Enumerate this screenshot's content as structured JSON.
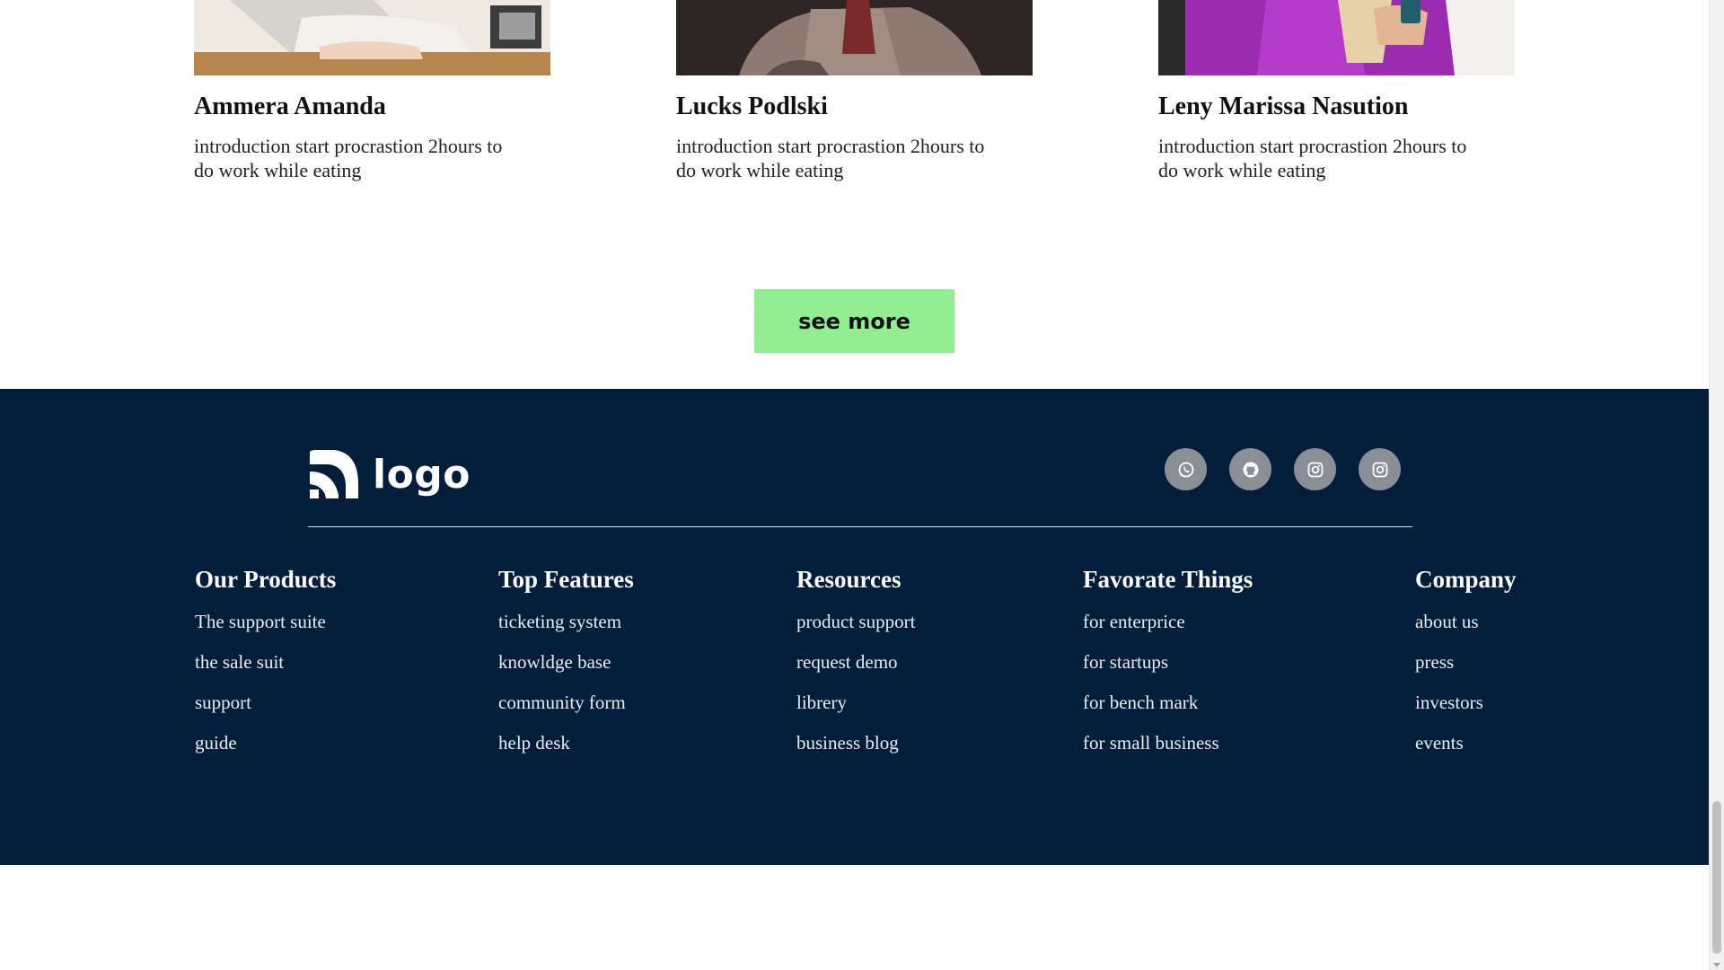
{
  "team": {
    "members": [
      {
        "name": "Ammera Amanda",
        "description": "introduction start procrastion 2hours to do work while eating"
      },
      {
        "name": "Lucks Podlski",
        "description": "introduction start procrastion 2hours to do work while eating"
      },
      {
        "name": "Leny Marissa Nasution",
        "description": "introduction start procrastion 2hours to do work while eating"
      }
    ],
    "see_more_label": "see more"
  },
  "footer": {
    "logo_text": "logo",
    "socials": [
      "whatsapp-icon",
      "github-icon",
      "instagram-icon",
      "instagram-icon"
    ],
    "columns": [
      {
        "title": "Our Products",
        "links": [
          "The support suite",
          "the sale suit",
          "support",
          "guide"
        ]
      },
      {
        "title": "Top Features",
        "links": [
          "ticketing system",
          "knowldge base",
          "community form",
          "help desk"
        ]
      },
      {
        "title": "Resources",
        "links": [
          "product support",
          "request demo",
          "librery",
          "business blog"
        ]
      },
      {
        "title": "Favorate Things",
        "links": [
          "for enterprice",
          "for startups",
          "for bench mark",
          "for small business"
        ]
      },
      {
        "title": "Company",
        "links": [
          "about us",
          "press",
          "investors",
          "events"
        ]
      }
    ]
  },
  "colors": {
    "accent": "#90ee90",
    "footer_bg": "#021e3a",
    "social_bg": "#8a8f96"
  }
}
